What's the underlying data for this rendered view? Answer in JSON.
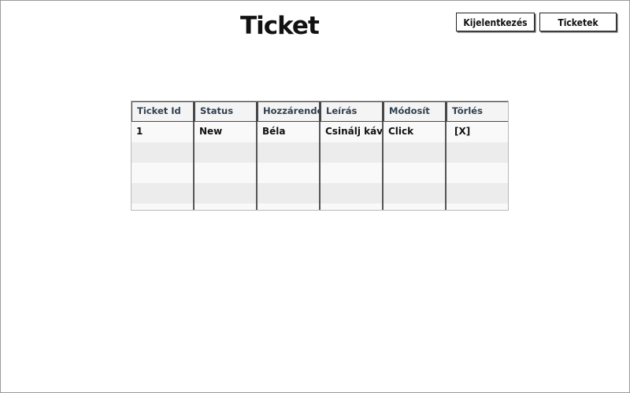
{
  "page": {
    "title": "Ticket"
  },
  "header_buttons": {
    "logout": "Kijelentkezés",
    "tickets": "Ticketek"
  },
  "table": {
    "columns": [
      "Ticket Id",
      "Status",
      "Hozzárendelt",
      "Leírás",
      "Módosít",
      "Törlés"
    ],
    "rows": [
      [
        "1",
        "New",
        "Béla",
        "Csinálj kávét",
        "Click",
        "[X]"
      ],
      [
        "",
        "",
        "",
        "",
        "",
        ""
      ],
      [
        "",
        "",
        "",
        "",
        "",
        ""
      ],
      [
        "",
        "",
        "",
        "",
        "",
        ""
      ],
      [
        "",
        "",
        "",
        "",
        "",
        ""
      ]
    ]
  }
}
